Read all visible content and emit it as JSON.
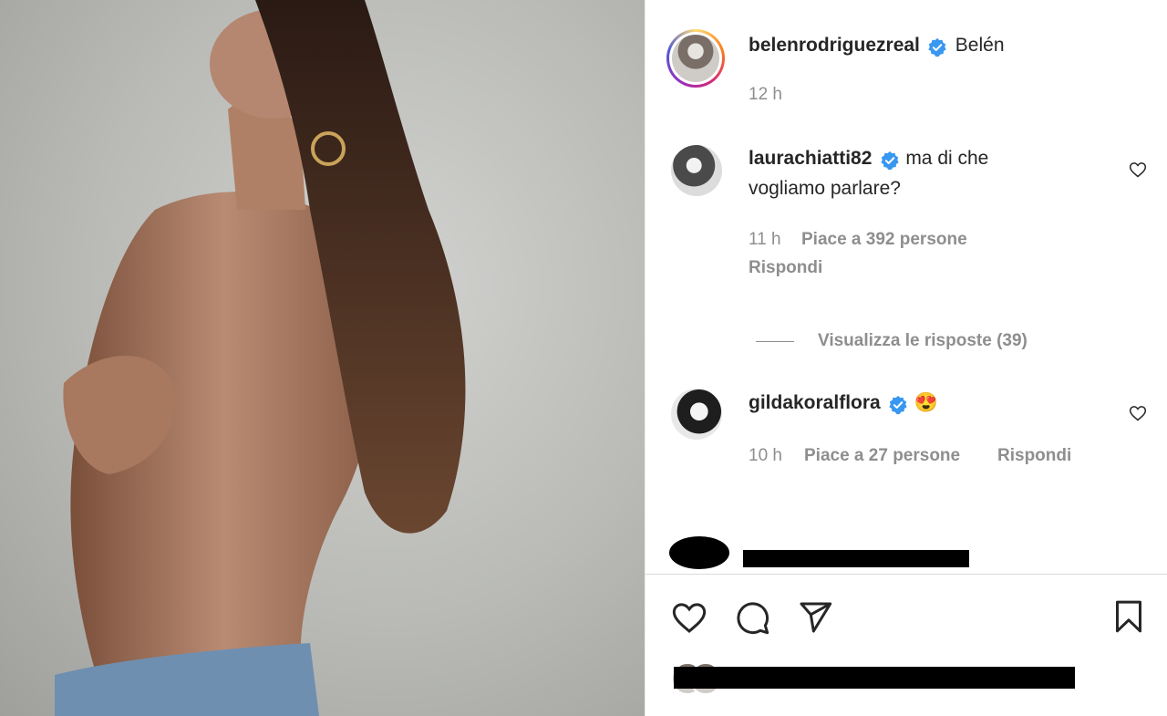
{
  "post": {
    "author": "belenrodriguezreal",
    "caption": "Belén",
    "time": "12 h"
  },
  "comments": [
    {
      "user": "laurachiatti82",
      "text_line1": "ma di che",
      "text_line2": "vogliamo parlare?",
      "time": "11 h",
      "likes": "Piace a 392 persone",
      "reply": "Rispondi"
    },
    {
      "user": "gildakoralflora",
      "text": "😍",
      "time": "10 h",
      "likes": "Piace a 27 persone",
      "reply": "Rispondi"
    }
  ],
  "view_replies": "Visualizza le risposte (39)",
  "icons": {
    "verified": "verified-badge-icon",
    "like": "heart-icon",
    "comment": "comment-icon",
    "share": "send-icon",
    "save": "bookmark-icon"
  },
  "colors": {
    "verified": "#3897f0",
    "meta": "#8e8e8e",
    "text": "#262626"
  }
}
